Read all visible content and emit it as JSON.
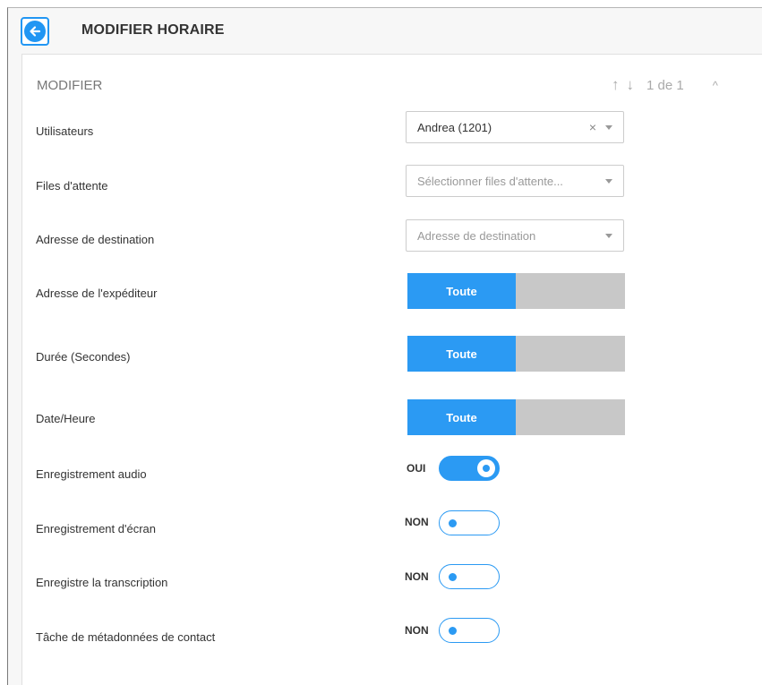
{
  "header": {
    "title": "MODIFIER HORAIRE",
    "back_icon": "arrow-left-icon"
  },
  "panel": {
    "title": "MODIFIER",
    "pager": {
      "up_icon": "↑",
      "down_icon": "↓",
      "count": "1 de 1",
      "collapse_icon": "^"
    }
  },
  "fields": {
    "users": {
      "label": "Utilisateurs",
      "value": "Andrea (1201)",
      "clear": "×"
    },
    "queues": {
      "label": "Files d'attente",
      "placeholder": "Sélectionner files d'attente..."
    },
    "destination": {
      "label": "Adresse de destination",
      "placeholder": "Adresse de destination"
    },
    "sender": {
      "label": "Adresse de l'expéditeur",
      "selected": "Toute"
    },
    "duration": {
      "label": "Durée (Secondes)",
      "selected": "Toute"
    },
    "datetime": {
      "label": "Date/Heure",
      "selected": "Toute"
    },
    "audio": {
      "label": "Enregistrement audio",
      "state": "OUI"
    },
    "screen": {
      "label": "Enregistrement d'écran",
      "state": "NON"
    },
    "transcription": {
      "label": "Enregistre la transcription",
      "state": "NON"
    },
    "metadata": {
      "label": "Tâche de métadonnées de contact",
      "state": "NON"
    }
  },
  "colors": {
    "accent": "#2b9af3",
    "segment_off": "#c8c8c8"
  }
}
